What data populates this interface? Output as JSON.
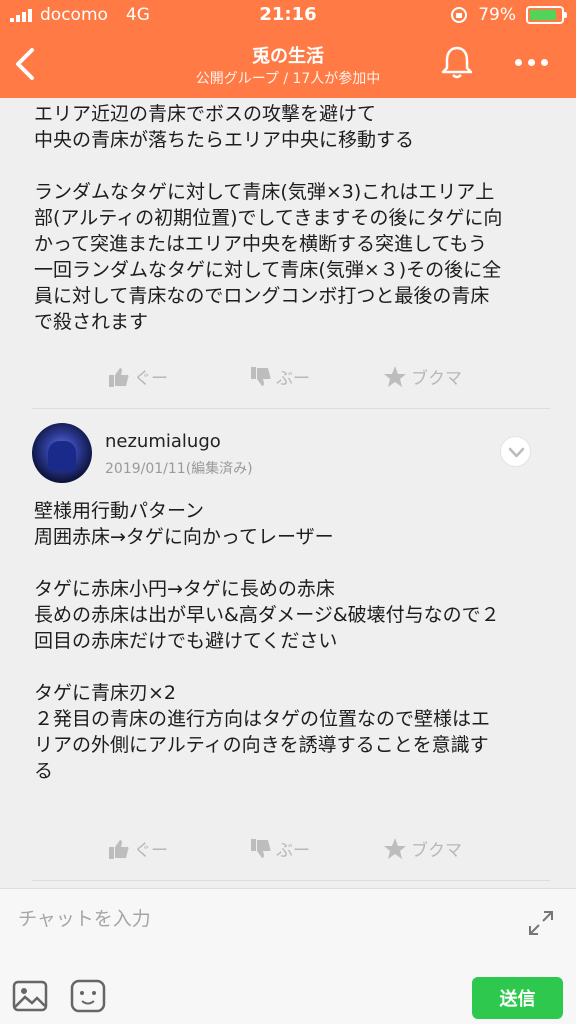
{
  "status_bar": {
    "carrier": "docomo",
    "network": "4G",
    "time": "21:16",
    "battery": "79%",
    "battery_level": 0.79
  },
  "header": {
    "title": "兎の生活",
    "subtitle": "公開グループ / 17人が参加中"
  },
  "post1": {
    "lines": [
      [
        "エリア近辺の青床でボスの攻撃を避けて",
        "中央の青床が落ちたらエリア中央に移動する"
      ],
      [
        "ランダムなタゲに対して青床(気弾×3)これはエリア上",
        "部(アルティの初期位置)でしてきますその後にタゲに向",
        "かって突進またはエリア中央を横断する突進してもう",
        "一回ランダムなタゲに対して青床(気弾×３)その後に全",
        "員に対して青床なのでロングコンボ打つと最後の青床",
        "で殺されます"
      ]
    ],
    "actions": {
      "like": "ぐー",
      "dislike": "ぶー",
      "bookmark": "ブクマ"
    }
  },
  "post2": {
    "author": "nezumialugo",
    "date": "2019/01/11(編集済み)",
    "lines": [
      [
        "壁様用行動パターン",
        "周囲赤床→タゲに向かってレーザー"
      ],
      [
        "タゲに赤床小円→タゲに長めの赤床",
        "長めの赤床は出が早い&高ダメージ&破壊付与なので２",
        "回目の赤床だけでも避けてください"
      ],
      [
        "タゲに青床刃×2",
        "２発目の青床の進行方向はタゲの位置なので壁様はエ",
        "リアの外側にアルティの向きを誘導することを意識す",
        "る"
      ]
    ],
    "actions": {
      "like": "ぐー",
      "dislike": "ぶー",
      "bookmark": "ブクマ"
    }
  },
  "composer": {
    "placeholder": "チャットを入力",
    "send_label": "送信"
  },
  "colors": {
    "header": "#ff7a45",
    "send": "#2ec84e",
    "action_gray": "#b8b8b8"
  }
}
